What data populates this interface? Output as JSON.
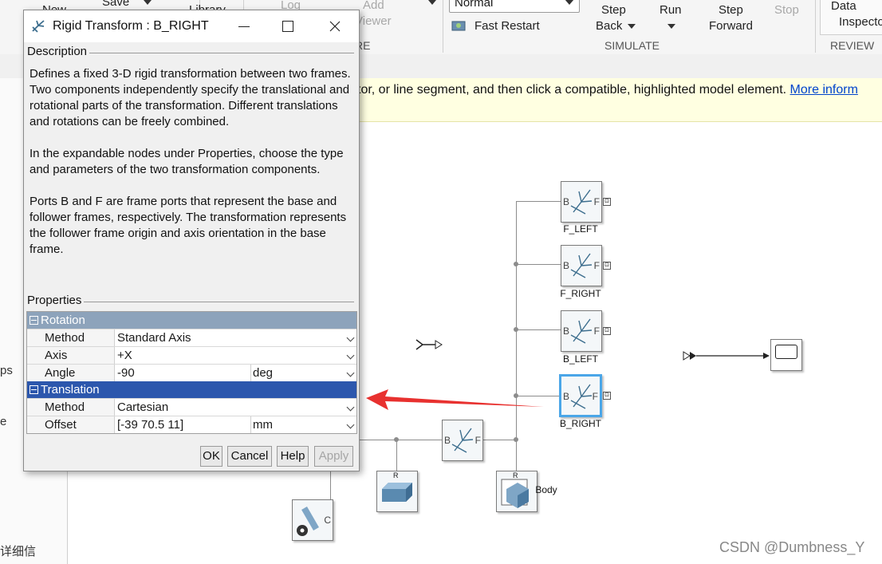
{
  "toolstrip": {
    "new_label": "New",
    "save_label": "Save",
    "library_label": "Library",
    "log_label": "Log",
    "add_viewer_label": "Add\nViewer",
    "sim_mode": "Normal",
    "fast_restart": "Fast Restart",
    "step_back": "Step\nBack",
    "run": "Run",
    "step_forward": "Step\nForward",
    "stop": "Stop",
    "data_inspector": "Data\nInspector",
    "group_prepare": "RE",
    "group_simulate": "SIMULATE",
    "group_review": "REVIEW R"
  },
  "banner": {
    "text": "tor, or line segment, and then click a compatible, highlighted model element.",
    "link": "More inform"
  },
  "left_pane": {
    "item1": "ps",
    "item2": "e",
    "item3": "详细信"
  },
  "model": {
    "blocks": [
      {
        "name": "F_LEFT"
      },
      {
        "name": "F_RIGHT"
      },
      {
        "name": "B_LEFT"
      },
      {
        "name": "B_RIGHT"
      }
    ],
    "body_label": "Body",
    "port_b": "B",
    "port_f": "F",
    "port_r": "R",
    "port_c": "C"
  },
  "dialog": {
    "title": "Rigid Transform : B_RIGHT",
    "description_header": "Description",
    "description": [
      "Defines a fixed 3-D rigid transformation between two frames. Two components independently specify the translational and rotational parts of the transformation. Different translations and rotations can be freely combined.",
      "In the expandable nodes under Properties, choose the type and parameters of the two transformation components.",
      "Ports B and F are frame ports that represent the base and follower frames, respectively. The transformation represents the follower frame origin and axis orientation in the base frame."
    ],
    "properties_header": "Properties",
    "rotation": {
      "group": "Rotation",
      "method_label": "Method",
      "method_value": "Standard Axis",
      "axis_label": "Axis",
      "axis_value": "+X",
      "angle_label": "Angle",
      "angle_value": "-90",
      "angle_unit": "deg"
    },
    "translation": {
      "group": "Translation",
      "method_label": "Method",
      "method_value": "Cartesian",
      "offset_label": "Offset",
      "offset_value": "[-39 70.5 11]",
      "offset_unit": "mm"
    },
    "buttons": {
      "ok": "OK",
      "cancel": "Cancel",
      "help": "Help",
      "apply": "Apply"
    }
  },
  "watermark": "CSDN @Dumbness_Y",
  "colors": {
    "group_header": "#8da3bb",
    "group_active": "#2c57ad",
    "selection": "#4aa6e8",
    "arrow": "#e8312f",
    "banner": "#ffffe1"
  }
}
